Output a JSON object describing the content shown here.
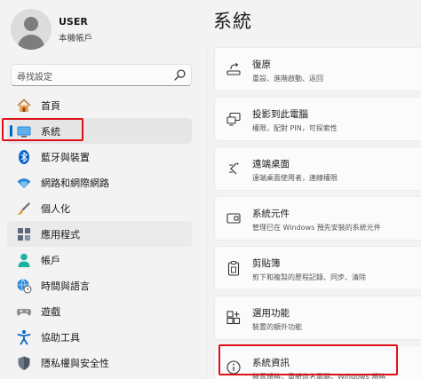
{
  "profile": {
    "name": "USER",
    "subtitle": "本機帳戶"
  },
  "search": {
    "placeholder": "尋找設定"
  },
  "nav": {
    "items": [
      {
        "label": "首頁",
        "icon": "home-icon"
      },
      {
        "label": "系統",
        "icon": "monitor-icon"
      },
      {
        "label": "藍牙與裝置",
        "icon": "bluetooth-icon"
      },
      {
        "label": "網路和網際網路",
        "icon": "wifi-icon"
      },
      {
        "label": "個人化",
        "icon": "brush-icon"
      },
      {
        "label": "應用程式",
        "icon": "apps-icon"
      },
      {
        "label": "帳戶",
        "icon": "person-icon"
      },
      {
        "label": "時間與語言",
        "icon": "globe-clock-icon"
      },
      {
        "label": "遊戲",
        "icon": "gamepad-icon"
      },
      {
        "label": "協助工具",
        "icon": "accessibility-icon"
      },
      {
        "label": "隱私權與安全性",
        "icon": "shield-icon"
      }
    ]
  },
  "page": {
    "title": "系統"
  },
  "cards": [
    {
      "title": "復原",
      "subtitle": "重設、進階啟動、返回",
      "icon": "recovery-icon"
    },
    {
      "title": "投影到此電腦",
      "subtitle": "權限，配對 PIN，可探索性",
      "icon": "project-icon"
    },
    {
      "title": "遠端桌面",
      "subtitle": "遠端桌面使用者，連線權限",
      "icon": "remote-desktop-icon"
    },
    {
      "title": "系統元件",
      "subtitle": "管理已在 Windows 預先安裝的系統元件",
      "icon": "system-components-icon"
    },
    {
      "title": "剪貼簿",
      "subtitle": "剪下和複製的歷程記錄、同步、清除",
      "icon": "clipboard-icon"
    },
    {
      "title": "選用功能",
      "subtitle": "裝置的額外功能",
      "icon": "optional-features-icon"
    },
    {
      "title": "系統資訊",
      "subtitle": "裝置規格，重新命名電腦，Windows 規格",
      "icon": "info-icon"
    }
  ],
  "colors": {
    "accent": "#0067c0",
    "highlight": "#e0101a"
  }
}
